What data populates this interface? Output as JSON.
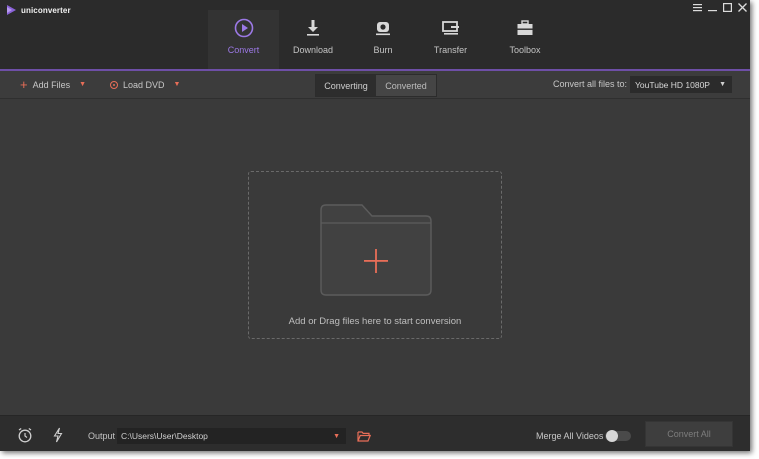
{
  "app": {
    "name": "uniconverter",
    "accent_color": "#7c5ccc",
    "window_controls": [
      "menu-icon",
      "minimize-icon",
      "maximize-icon",
      "close-icon"
    ]
  },
  "nav": {
    "tabs": [
      {
        "label": "Convert",
        "icon": "convert-play-icon",
        "active": true
      },
      {
        "label": "Download",
        "icon": "download-icon",
        "active": false
      },
      {
        "label": "Burn",
        "icon": "burn-disc-icon",
        "active": false
      },
      {
        "label": "Transfer",
        "icon": "transfer-icon",
        "active": false
      },
      {
        "label": "Toolbox",
        "icon": "toolbox-icon",
        "active": false
      }
    ]
  },
  "toolbar": {
    "add_files_label": "Add Files",
    "load_dvd_label": "Load DVD",
    "segment": {
      "converting_label": "Converting",
      "converted_label": "Converted",
      "active": "Converting"
    },
    "convert_all_to_label": "Convert all files to:",
    "format_selected": "YouTube HD 1080P",
    "icon_color": "#e86e58"
  },
  "main": {
    "drop_hint": "Add or Drag files here to start conversion"
  },
  "bottom": {
    "output_label": "Output",
    "output_path": "C:\\Users\\User\\Desktop",
    "merge_label": "Merge All Videos",
    "merge_enabled": false,
    "convert_all_label": "Convert All"
  }
}
